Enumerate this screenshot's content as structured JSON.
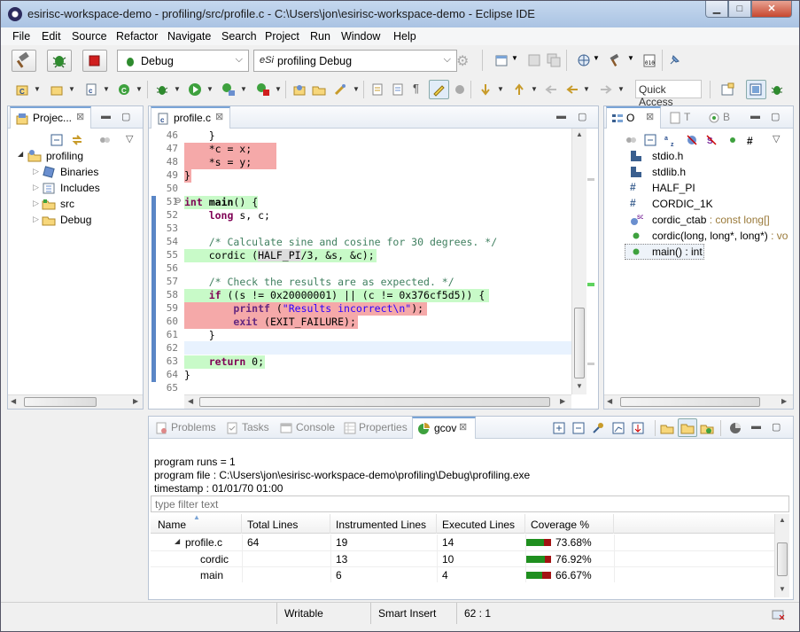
{
  "window": {
    "title": "esirisc-workspace-demo - profiling/src/profile.c - C:\\Users\\jon\\esirisc-workspace-demo - Eclipse IDE"
  },
  "menu": [
    "File",
    "Edit",
    "Source",
    "Refactor",
    "Navigate",
    "Search",
    "Project",
    "Run",
    "Window",
    "Help"
  ],
  "toolbar": {
    "build_config": "Debug",
    "launch_config": "profiling Debug",
    "launch_prefix": "eSi",
    "quick_access": "Quick Access"
  },
  "project_explorer": {
    "tab": "Projec...",
    "tree": [
      {
        "label": "profiling"
      },
      {
        "label": "Binaries"
      },
      {
        "label": "Includes"
      },
      {
        "label": "src"
      },
      {
        "label": "Debug"
      }
    ]
  },
  "editor": {
    "tab": "profile.c",
    "line_numbers": [
      "46",
      "47",
      "48",
      "49",
      "50",
      "51",
      "52",
      "53",
      "54",
      "55",
      "56",
      "57",
      "58",
      "59",
      "60",
      "61",
      "62",
      "63",
      "64",
      "65"
    ]
  },
  "outline": {
    "tabs": [
      "O",
      "T",
      "B"
    ],
    "items": [
      {
        "label": "stdio.h"
      },
      {
        "label": "stdlib.h"
      },
      {
        "label": "HALF_PI"
      },
      {
        "label": "CORDIC_1K"
      },
      {
        "label": "cordic_ctab",
        "type": " : const long[]"
      },
      {
        "label": "cordic(long, long*, long*)",
        "type": " : vo"
      },
      {
        "label": "main()",
        "type": " : int"
      }
    ]
  },
  "bottom_tabs": [
    "Problems",
    "Tasks",
    "Console",
    "Properties",
    "gcov"
  ],
  "gcov": {
    "runs": "program runs = 1",
    "file": "program file : C:\\Users\\jon\\esirisc-workspace-demo\\profiling\\Debug\\profiling.exe",
    "timestamp": "timestamp : 01/01/70 01:00",
    "filter_placeholder": "type filter text",
    "columns": [
      "Name",
      "Total Lines",
      "Instrumented Lines",
      "Executed Lines",
      "Coverage %"
    ],
    "rows": [
      {
        "name": "profile.c",
        "total": "64",
        "instrumented": "19",
        "executed": "14",
        "coverage": "73.68%",
        "fraction": 0.7368
      },
      {
        "name": "cordic",
        "total": "",
        "instrumented": "13",
        "executed": "10",
        "coverage": "76.92%",
        "fraction": 0.7692
      },
      {
        "name": "main",
        "total": "",
        "instrumented": "6",
        "executed": "4",
        "coverage": "66.67%",
        "fraction": 0.6667
      }
    ]
  },
  "status": {
    "writable": "Writable",
    "insert_mode": "Smart Insert",
    "position": "62 : 1"
  },
  "colors": {
    "covered": "#c8fac8",
    "uncovered": "#f5a9a9",
    "bar_green": "#1f8f1f",
    "bar_red": "#a31313"
  }
}
